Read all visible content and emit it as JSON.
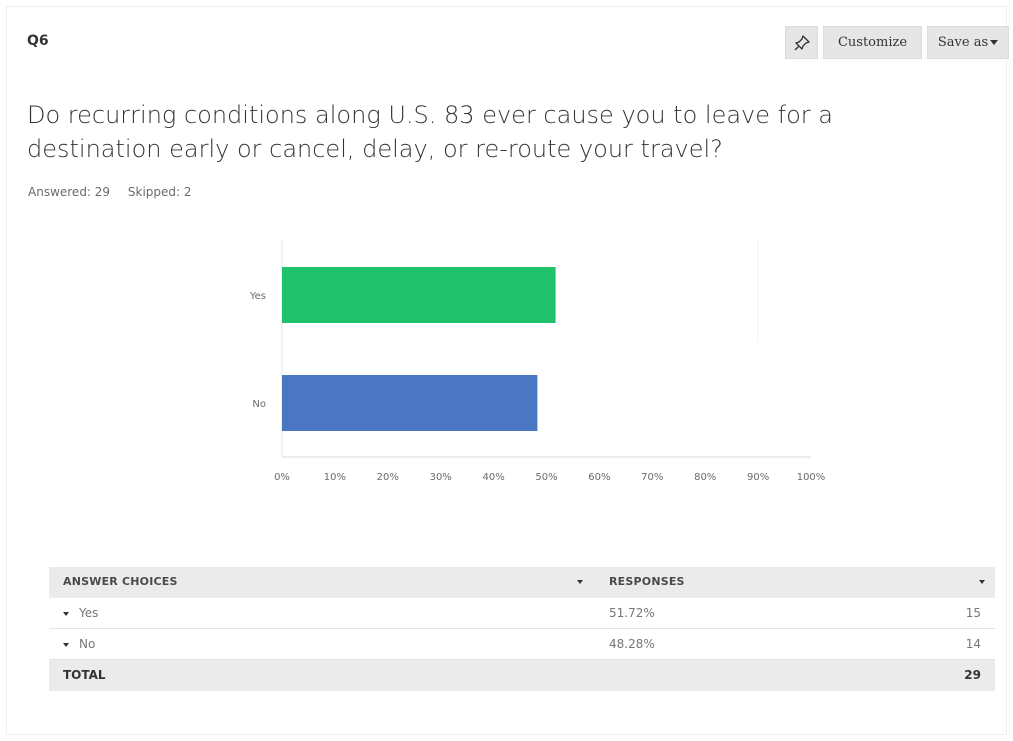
{
  "question": {
    "number": "Q6",
    "title": "Do recurring conditions along U.S. 83 ever cause you to leave for a destination early or cancel, delay, or re-route your travel?",
    "answered": "Answered: 29",
    "skipped": "Skipped: 2"
  },
  "toolbar": {
    "pin_icon": "pin-icon",
    "customize_label": "Customize",
    "save_label": "Save as"
  },
  "chart_data": {
    "type": "bar",
    "orientation": "horizontal",
    "categories": [
      "Yes",
      "No"
    ],
    "values": [
      51.72,
      48.28
    ],
    "colors": [
      "#1fc16b",
      "#4a76c2"
    ],
    "xticks": [
      "0%",
      "10%",
      "20%",
      "30%",
      "40%",
      "50%",
      "60%",
      "70%",
      "80%",
      "90%",
      "100%"
    ],
    "xlim": [
      0,
      100
    ]
  },
  "table": {
    "headers": [
      "ANSWER CHOICES",
      "RESPONSES"
    ],
    "rows": [
      {
        "choice": "Yes",
        "percent": "51.72%",
        "count": "15"
      },
      {
        "choice": "No",
        "percent": "48.28%",
        "count": "14"
      }
    ],
    "total_label": "TOTAL",
    "total_count": "29"
  }
}
